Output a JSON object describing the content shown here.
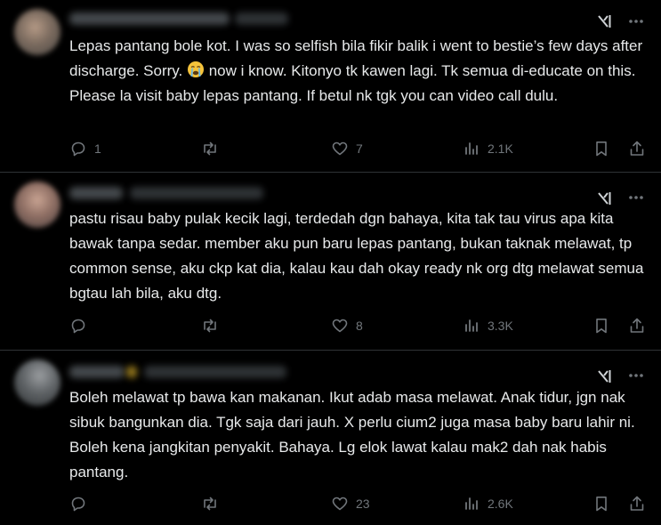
{
  "posts": [
    {
      "text_parts": [
        "Lepas pantang bole kot. I was so selfish bila fikir balik i went to bestie’s few days after discharge. Sorry. ",
        " now i know. Kitonyo tk kawen lagi. Tk semua di-educate on this. Please la visit baby lepas pantang. If betul nk tgk you can video call dulu."
      ],
      "emoji": "loudly-crying-face-icon",
      "replies": "1",
      "reposts": "",
      "likes": "7",
      "views": "2.1K"
    },
    {
      "text_parts": [
        "pastu risau baby pulak kecik lagi, terdedah dgn bahaya, kita tak tau virus apa kita bawak tanpa sedar. member aku pun baru lepas pantang, bukan taknak melawat, tp common sense, aku ckp kat dia, kalau kau dah okay ready nk org dtg melawat semua bgtau lah bila, aku dtg.",
        ""
      ],
      "emoji": "",
      "replies": "",
      "reposts": "",
      "likes": "8",
      "views": "3.3K"
    },
    {
      "text_parts": [
        "Boleh melawat tp bawa kan makanan. Ikut adab masa melawat. Anak tidur, jgn nak sibuk bangunkan dia. Tgk saja dari jauh. X perlu cium2 juga masa baby baru lahir ni. Boleh kena jangkitan penyakit. Bahaya. Lg elok lawat kalau mak2 dah nak habis pantang.",
        ""
      ],
      "emoji": "",
      "replies": "",
      "reposts": "",
      "likes": "23",
      "views": "2.6K"
    }
  ],
  "colors": {
    "background": "#000000",
    "text": "#e7e9ea",
    "muted": "#71767b",
    "divider": "#2f3336"
  }
}
